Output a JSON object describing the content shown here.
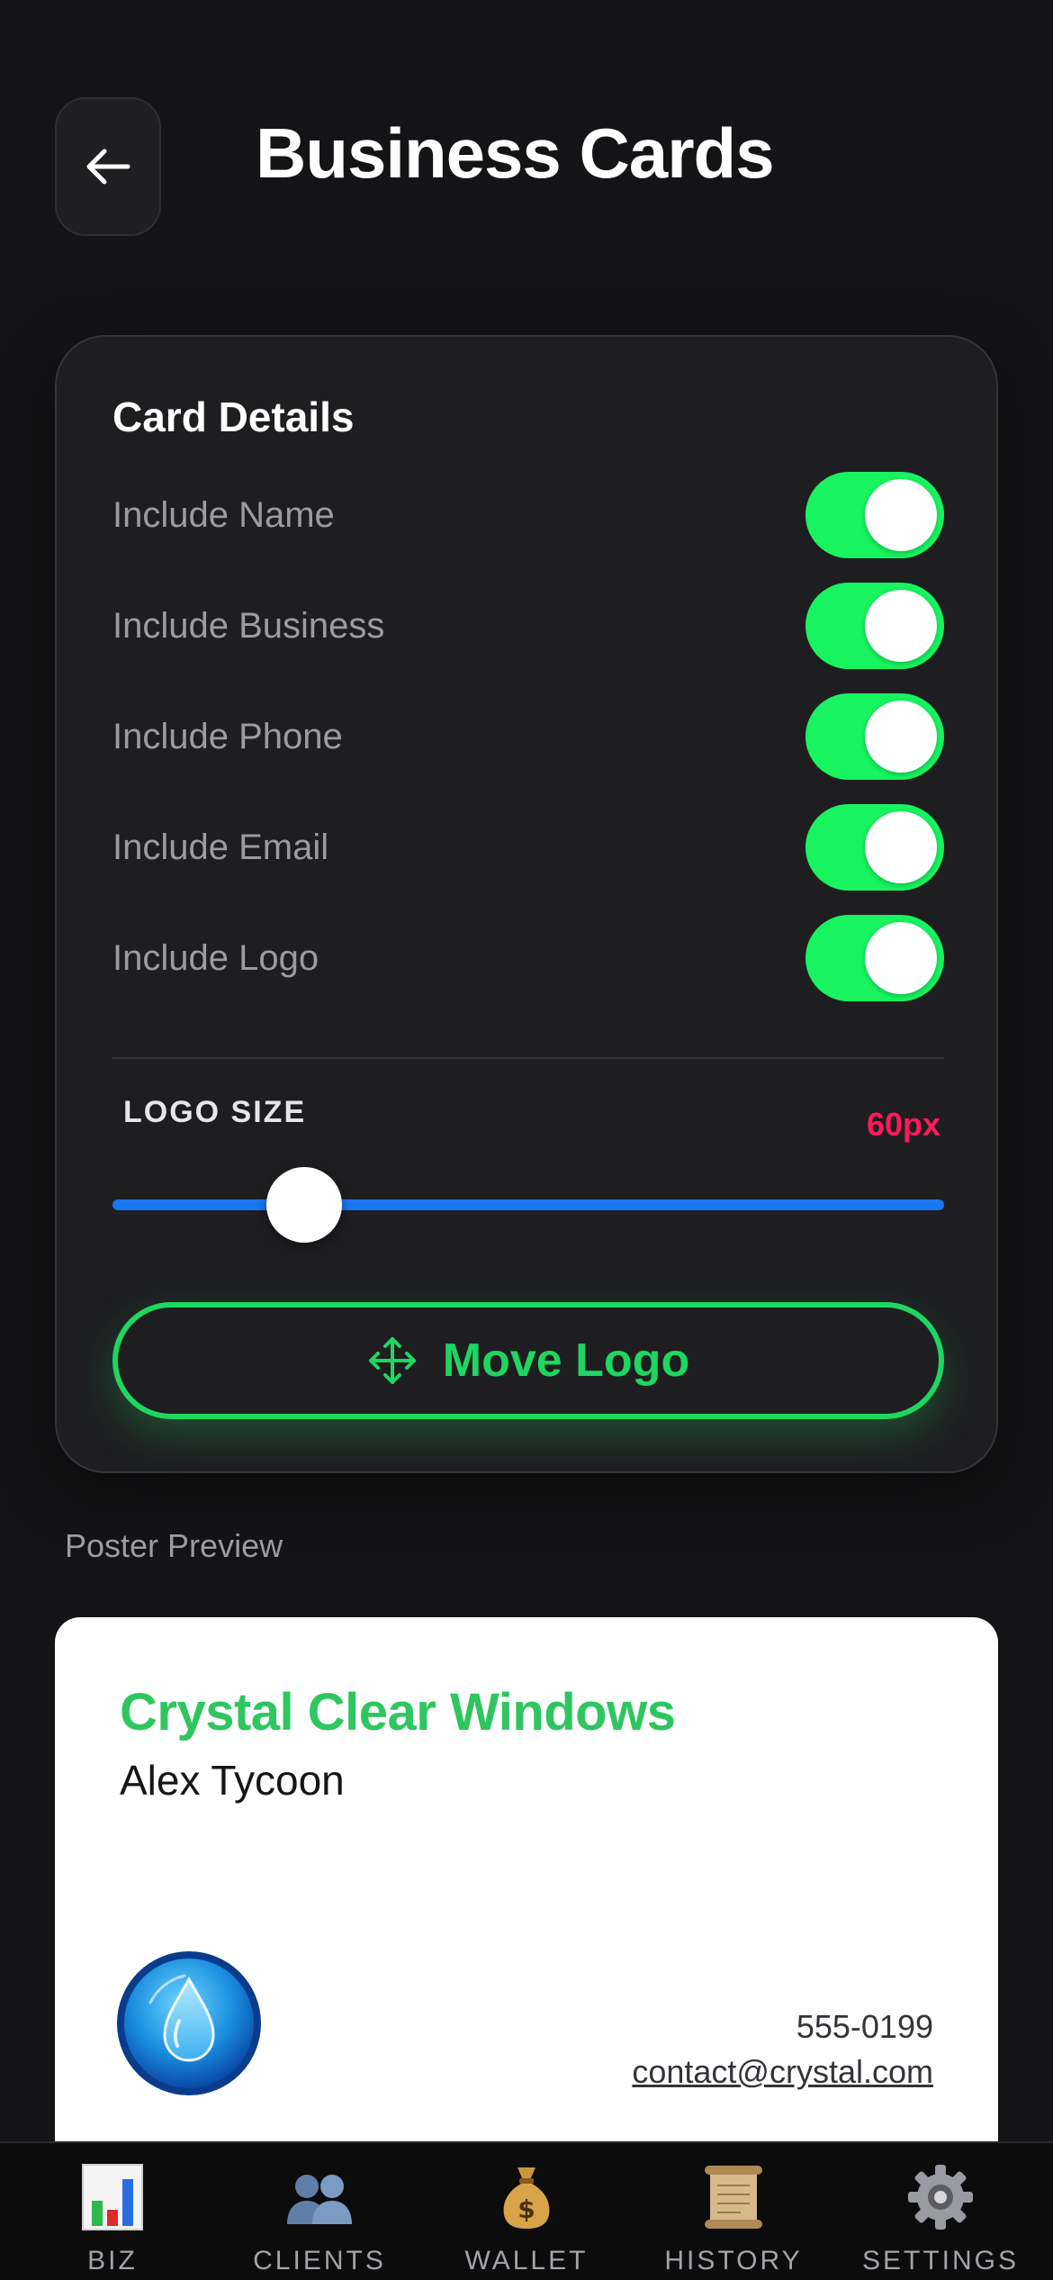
{
  "header": {
    "title": "Business Cards",
    "back_icon": "arrow-left-icon"
  },
  "card_details": {
    "title": "Card Details",
    "toggles": [
      {
        "label": "Include Name",
        "on": true
      },
      {
        "label": "Include Business",
        "on": true
      },
      {
        "label": "Include Phone",
        "on": true
      },
      {
        "label": "Include Email",
        "on": true
      },
      {
        "label": "Include Logo",
        "on": true
      }
    ],
    "logo_size": {
      "label": "LOGO SIZE",
      "value_text": "60px",
      "fraction": 0.23
    },
    "move_logo": {
      "label": "Move Logo",
      "icon": "move-arrows-icon"
    }
  },
  "preview": {
    "section_label": "Poster Preview",
    "business_name": "Crystal Clear Windows",
    "person_name": "Alex Tycoon",
    "phone": "555-0199",
    "email": "contact@crystal.com",
    "logo_icon": "water-drop-icon"
  },
  "tabbar": {
    "items": [
      {
        "label": "BIZ",
        "icon": "bar-chart-icon"
      },
      {
        "label": "CLIENTS",
        "icon": "people-icon"
      },
      {
        "label": "WALLET",
        "icon": "money-bag-icon"
      },
      {
        "label": "HISTORY",
        "icon": "scroll-icon"
      },
      {
        "label": "SETTINGS",
        "icon": "gear-icon"
      }
    ]
  },
  "colors": {
    "background": "#141416",
    "toggle_on": "#17f45f",
    "accent_green": "#1ed760",
    "slider_blue": "#1877f2",
    "value_red": "#ff1a5c",
    "business_green": "#2ec65f"
  }
}
